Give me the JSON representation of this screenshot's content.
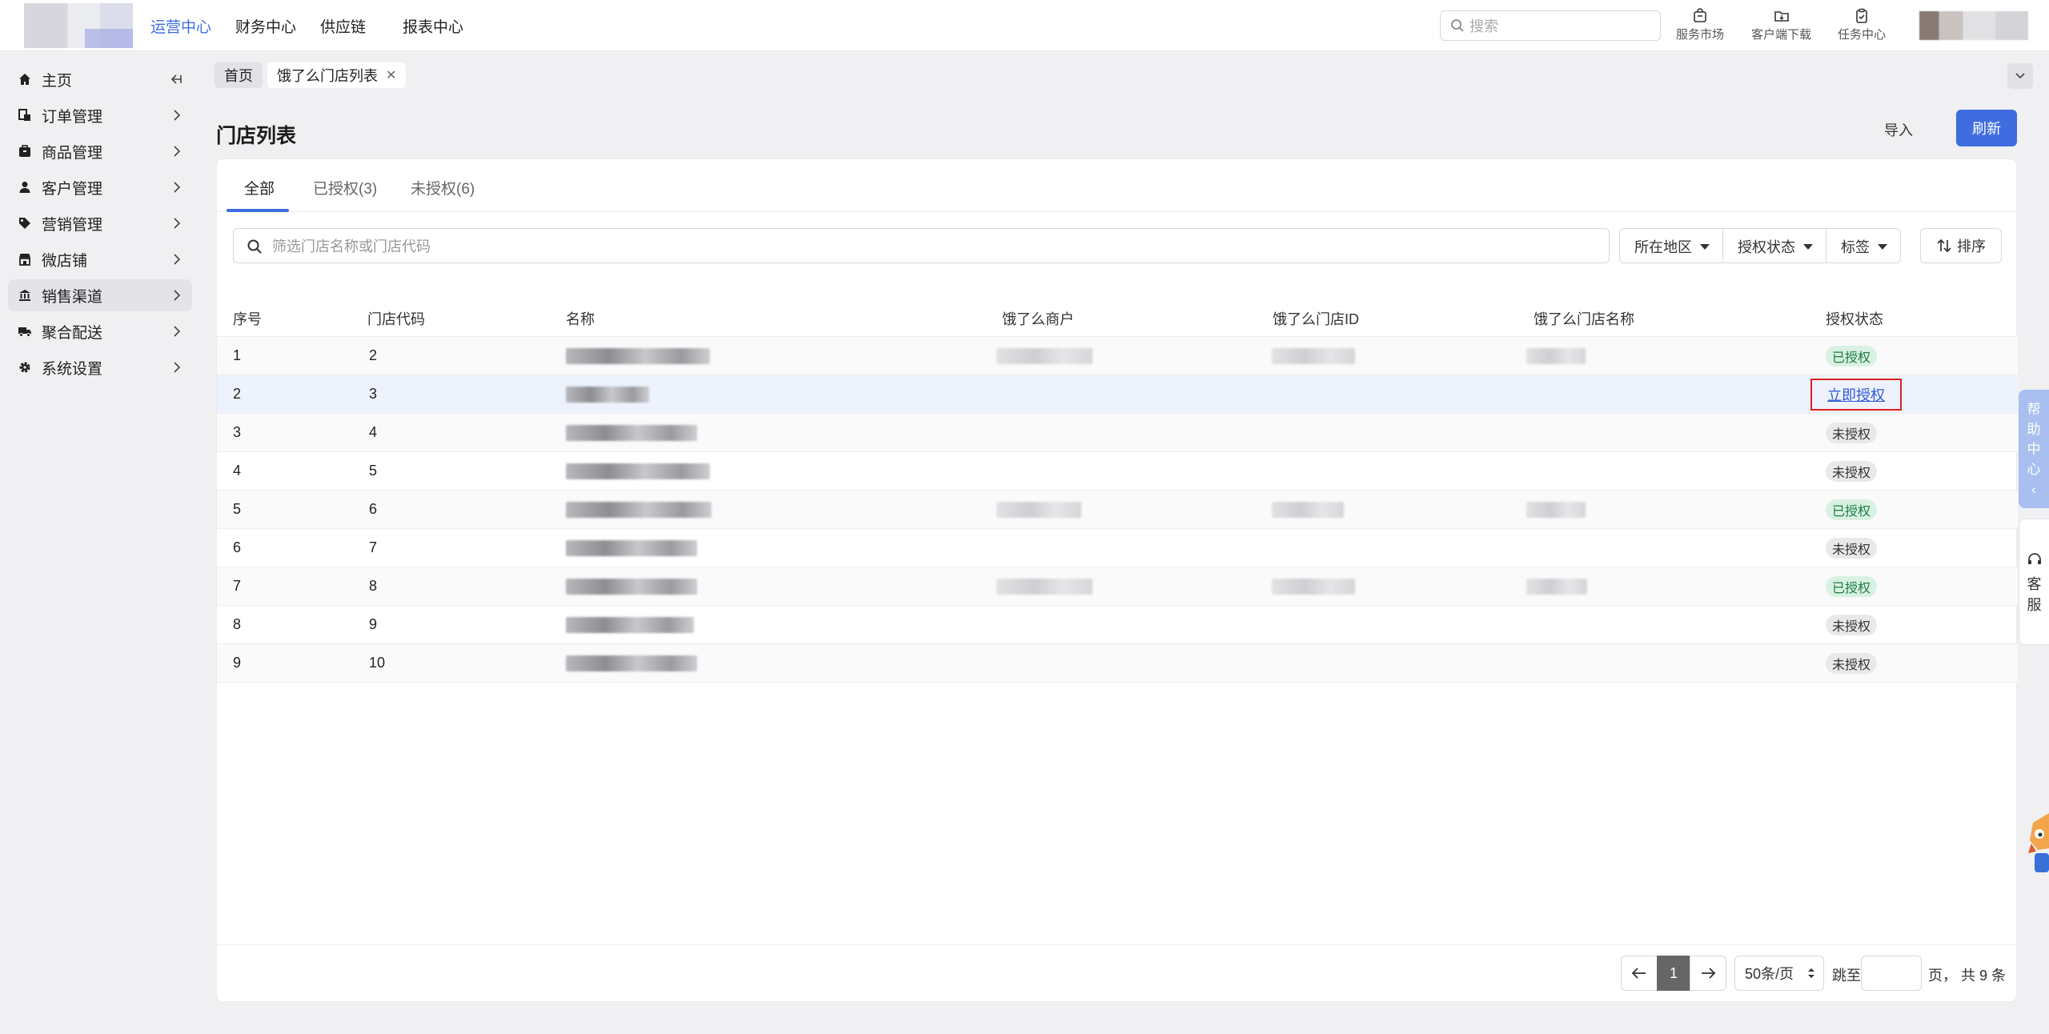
{
  "topnav": {
    "items": [
      "运营中心",
      "财务中心",
      "供应链",
      "报表中心"
    ],
    "search_placeholder": "搜索",
    "tools": [
      "服务市场",
      "客户端下载",
      "任务中心"
    ]
  },
  "sidebar": {
    "items": [
      "主页",
      "订单管理",
      "商品管理",
      "客户管理",
      "营销管理",
      "微店铺",
      "销售渠道",
      "聚合配送",
      "系统设置"
    ]
  },
  "breadcrumbs": [
    "首页",
    "饿了么门店列表"
  ],
  "page": {
    "title": "门店列表",
    "import_label": "导入",
    "refresh_label": "刷新"
  },
  "tabs": [
    "全部",
    "已授权(3)",
    "未授权(6)"
  ],
  "filter": {
    "placeholder": "筛选门店名称或门店代码",
    "dropdowns": [
      "所在地区",
      "授权状态",
      "标签"
    ],
    "sort_label": "排序"
  },
  "table": {
    "headers": [
      "序号",
      "门店代码",
      "名称",
      "饿了么商户",
      "饿了么门店ID",
      "饿了么门店名称",
      "授权状态"
    ],
    "rows": [
      {
        "no": "1",
        "code": "2",
        "status": "已授权"
      },
      {
        "no": "2",
        "code": "3",
        "status": "立即授权"
      },
      {
        "no": "3",
        "code": "4",
        "status": "未授权"
      },
      {
        "no": "4",
        "code": "5",
        "status": "未授权"
      },
      {
        "no": "5",
        "code": "6",
        "status": "已授权"
      },
      {
        "no": "6",
        "code": "7",
        "status": "未授权"
      },
      {
        "no": "7",
        "code": "8",
        "status": "已授权"
      },
      {
        "no": "8",
        "code": "9",
        "status": "未授权"
      },
      {
        "no": "9",
        "code": "10",
        "status": "未授权"
      }
    ]
  },
  "pagination": {
    "current": "1",
    "page_size": "50条/页",
    "jump_label": "跳至",
    "summary": "页， 共 9 条"
  },
  "float": {
    "help": [
      "帮",
      "助",
      "中",
      "心",
      "‹"
    ],
    "kefu": [
      "客",
      "服"
    ]
  },
  "colors": {
    "accent": "#3f6de0",
    "authorized_bg": "#d8f1e2",
    "unauthorized_bg": "#e9e9ec",
    "highlight_border": "#e02020"
  }
}
